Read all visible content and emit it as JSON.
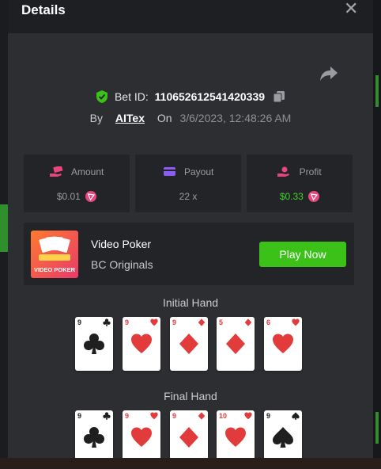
{
  "modal": {
    "title": "Details",
    "close_symbol": "✕"
  },
  "bet": {
    "id_label": "Bet ID:",
    "id_value": "110652612541420339",
    "by_label": "By",
    "user": "AITex",
    "on_label": "On",
    "date": "3/6/2023, 12:48:26 AM"
  },
  "stats": {
    "amount": {
      "label": "Amount",
      "value": "$0.01",
      "icon": "money-hand-icon",
      "color": "#e8467c"
    },
    "payout": {
      "label": "Payout",
      "value": "22 x",
      "icon": "card-icon",
      "color": "#8b5cf6"
    },
    "profit": {
      "label": "Profit",
      "value": "$0.33",
      "icon": "hand-coin-icon",
      "color": "#e8467c",
      "value_color": "#3fd32a"
    }
  },
  "game": {
    "name": "Video Poker",
    "provider": "BC Originals",
    "thumb_text": "VIDEO POKER",
    "play_label": "Play Now",
    "play_color": "#3bc117"
  },
  "hands": {
    "initial": {
      "title": "Initial Hand",
      "cards": [
        {
          "rank": "9",
          "suit": "clubs"
        },
        {
          "rank": "9",
          "suit": "hearts"
        },
        {
          "rank": "9",
          "suit": "diamonds"
        },
        {
          "rank": "5",
          "suit": "diamonds"
        },
        {
          "rank": "6",
          "suit": "hearts"
        }
      ]
    },
    "final": {
      "title": "Final Hand",
      "cards": [
        {
          "rank": "9",
          "suit": "clubs"
        },
        {
          "rank": "9",
          "suit": "hearts"
        },
        {
          "rank": "9",
          "suit": "diamonds"
        },
        {
          "rank": "10",
          "suit": "hearts"
        },
        {
          "rank": "9",
          "suit": "spades"
        }
      ]
    }
  }
}
